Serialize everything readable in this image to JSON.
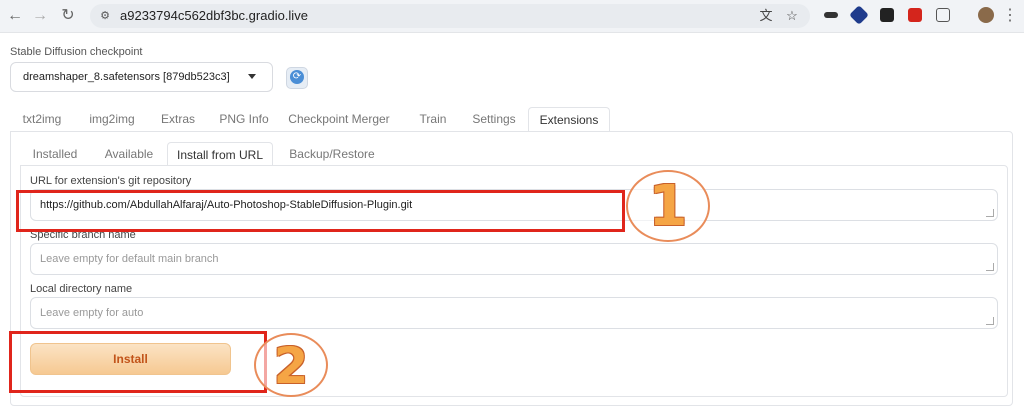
{
  "browser": {
    "url": "a9233794c562dbf3bc.gradio.live"
  },
  "checkpoint": {
    "label": "Stable Diffusion checkpoint",
    "value": "dreamshaper_8.safetensors [879db523c3]"
  },
  "tabs": [
    {
      "label": "txt2img"
    },
    {
      "label": "img2img"
    },
    {
      "label": "Extras"
    },
    {
      "label": "PNG Info"
    },
    {
      "label": "Checkpoint Merger"
    },
    {
      "label": "Train"
    },
    {
      "label": "Settings"
    },
    {
      "label": "Extensions",
      "active": true
    }
  ],
  "subtabs": [
    {
      "label": "Installed"
    },
    {
      "label": "Available"
    },
    {
      "label": "Install from URL",
      "active": true
    },
    {
      "label": "Backup/Restore"
    }
  ],
  "form": {
    "url_label": "URL for extension's git repository",
    "url_value": "https://github.com/AbdullahAlfaraj/Auto-Photoshop-StableDiffusion-Plugin.git",
    "branch_label": "Specific branch name",
    "branch_placeholder": "Leave empty for default main branch",
    "dir_label": "Local directory name",
    "dir_placeholder": "Leave empty for auto",
    "install_label": "Install"
  },
  "annotations": {
    "step1": "1",
    "step2": "2",
    "highlight_color": "#e0251b",
    "number_color": "#f5a545"
  },
  "colors": {
    "install_button": "#f6c992",
    "install_text": "#c2541a"
  }
}
